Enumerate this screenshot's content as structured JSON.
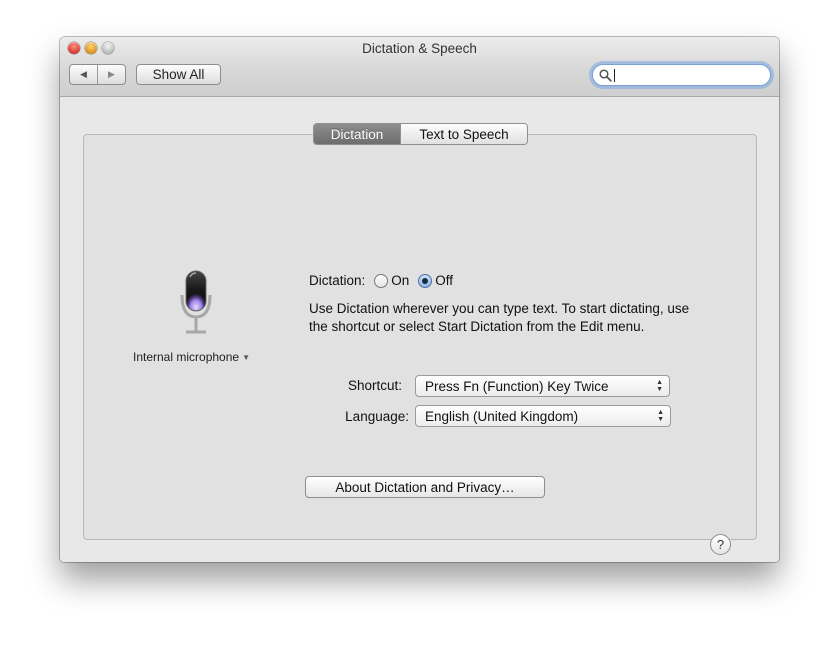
{
  "window": {
    "title": "Dictation & Speech"
  },
  "toolbar": {
    "back_icon": "◀",
    "forward_icon": "▶",
    "show_all_label": "Show All",
    "search_value": ""
  },
  "tabs": [
    {
      "label": "Dictation",
      "active": true
    },
    {
      "label": "Text to Speech",
      "active": false
    }
  ],
  "microphone": {
    "icon": "microphone-icon",
    "selected": "Internal microphone"
  },
  "dictation": {
    "label": "Dictation:",
    "options": [
      {
        "label": "On",
        "selected": false
      },
      {
        "label": "Off",
        "selected": true
      }
    ],
    "description": "Use Dictation wherever you can type text. To start dictating, use the shortcut or select Start Dictation from the Edit menu."
  },
  "shortcut": {
    "label": "Shortcut:",
    "value": "Press Fn (Function) Key Twice"
  },
  "language": {
    "label": "Language:",
    "value": "English (United Kingdom)"
  },
  "about_button": "About Dictation and Privacy…",
  "help_label": "?",
  "colors": {
    "accent": "#7aa0d4",
    "active_tab": "#7d7d7d",
    "mic_glow": "#8a6fd8"
  }
}
